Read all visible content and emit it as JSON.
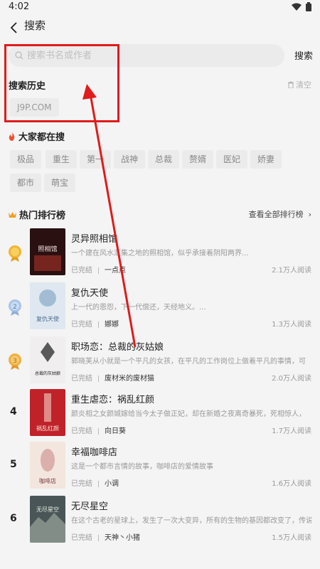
{
  "status": {
    "time": "4:02"
  },
  "header": {
    "title": "搜索"
  },
  "search": {
    "placeholder": "搜索书名或作者",
    "button": "搜索"
  },
  "history": {
    "title": "搜索历史",
    "clear": "清空",
    "items": [
      "J9P.COM"
    ]
  },
  "hot_search": {
    "title": "大家都在搜",
    "tags": [
      "极品",
      "重生",
      "第一",
      "战神",
      "总裁",
      "赘婿",
      "医妃",
      "娇妻",
      "都市",
      "萌宝"
    ]
  },
  "ranking": {
    "title": "热门排行榜",
    "view_all": "查看全部排行榜",
    "books": [
      {
        "rank": "1",
        "title": "灵异照相馆",
        "desc": "一个建在风水汇集之地的照相馆，似乎承接着阴阳两界...",
        "status": "已完结",
        "author": "一点点",
        "reads": "2.1万人阅读"
      },
      {
        "rank": "2",
        "title": "复仇天使",
        "desc": "上一代的恩怨，下一代偿还，天经地义。...",
        "status": "已完结",
        "author": "娜娜",
        "reads": "1.3万人阅读"
      },
      {
        "rank": "3",
        "title": "职场恋：总裁的灰姑娘",
        "desc": "郭晓芙从小就是一个平凡的女孩，在平凡的工作岗位上做着平凡的事情，可",
        "status": "已完结",
        "author": "废材米的废材猫",
        "reads": "2.0万人阅读"
      },
      {
        "rank": "4",
        "title": "重生虐恋：祸乱红颜",
        "desc": "颜炎相之女颜城嫁给当今太子做正妃，却在新婚之夜离奇暴死，死相惊人，",
        "status": "已完结",
        "author": "向日葵",
        "reads": "1.7万人阅读"
      },
      {
        "rank": "5",
        "title": "幸福咖啡店",
        "desc": "这是一个都市言情的故事，咖啡店的爱情故事",
        "status": "已完结",
        "author": "小调",
        "reads": "1.6万人阅读"
      },
      {
        "rank": "6",
        "title": "无尽星空",
        "desc": "在这个古老的星球上，发生了一次大变异，所有的生物的基因都改变了，传说",
        "status": "已完结",
        "author": "天神丶小猪",
        "reads": "1.5万人阅读"
      }
    ]
  },
  "covers": [
    {
      "text": "照相馆",
      "bg": "#2a1010",
      "accent": "#c0392b"
    },
    {
      "text": "复仇天使",
      "bg": "#dfe8f0",
      "accent": "#7aa0c0"
    },
    {
      "text": "总裁的灰姑娘",
      "bg": "#f0eeee",
      "accent": "#333333"
    },
    {
      "text": "祸乱红颜",
      "bg": "#c0222a",
      "accent": "#f3d4c4"
    },
    {
      "text": "咖啡店",
      "bg": "#f3e6df",
      "accent": "#c98a8a"
    },
    {
      "text": "无尽星空",
      "bg": "#4a5558",
      "accent": "#d8e0d0"
    }
  ],
  "colors": {
    "accent": "#f0a020",
    "annotation": "#e01b1b",
    "hot": "#f05030"
  }
}
